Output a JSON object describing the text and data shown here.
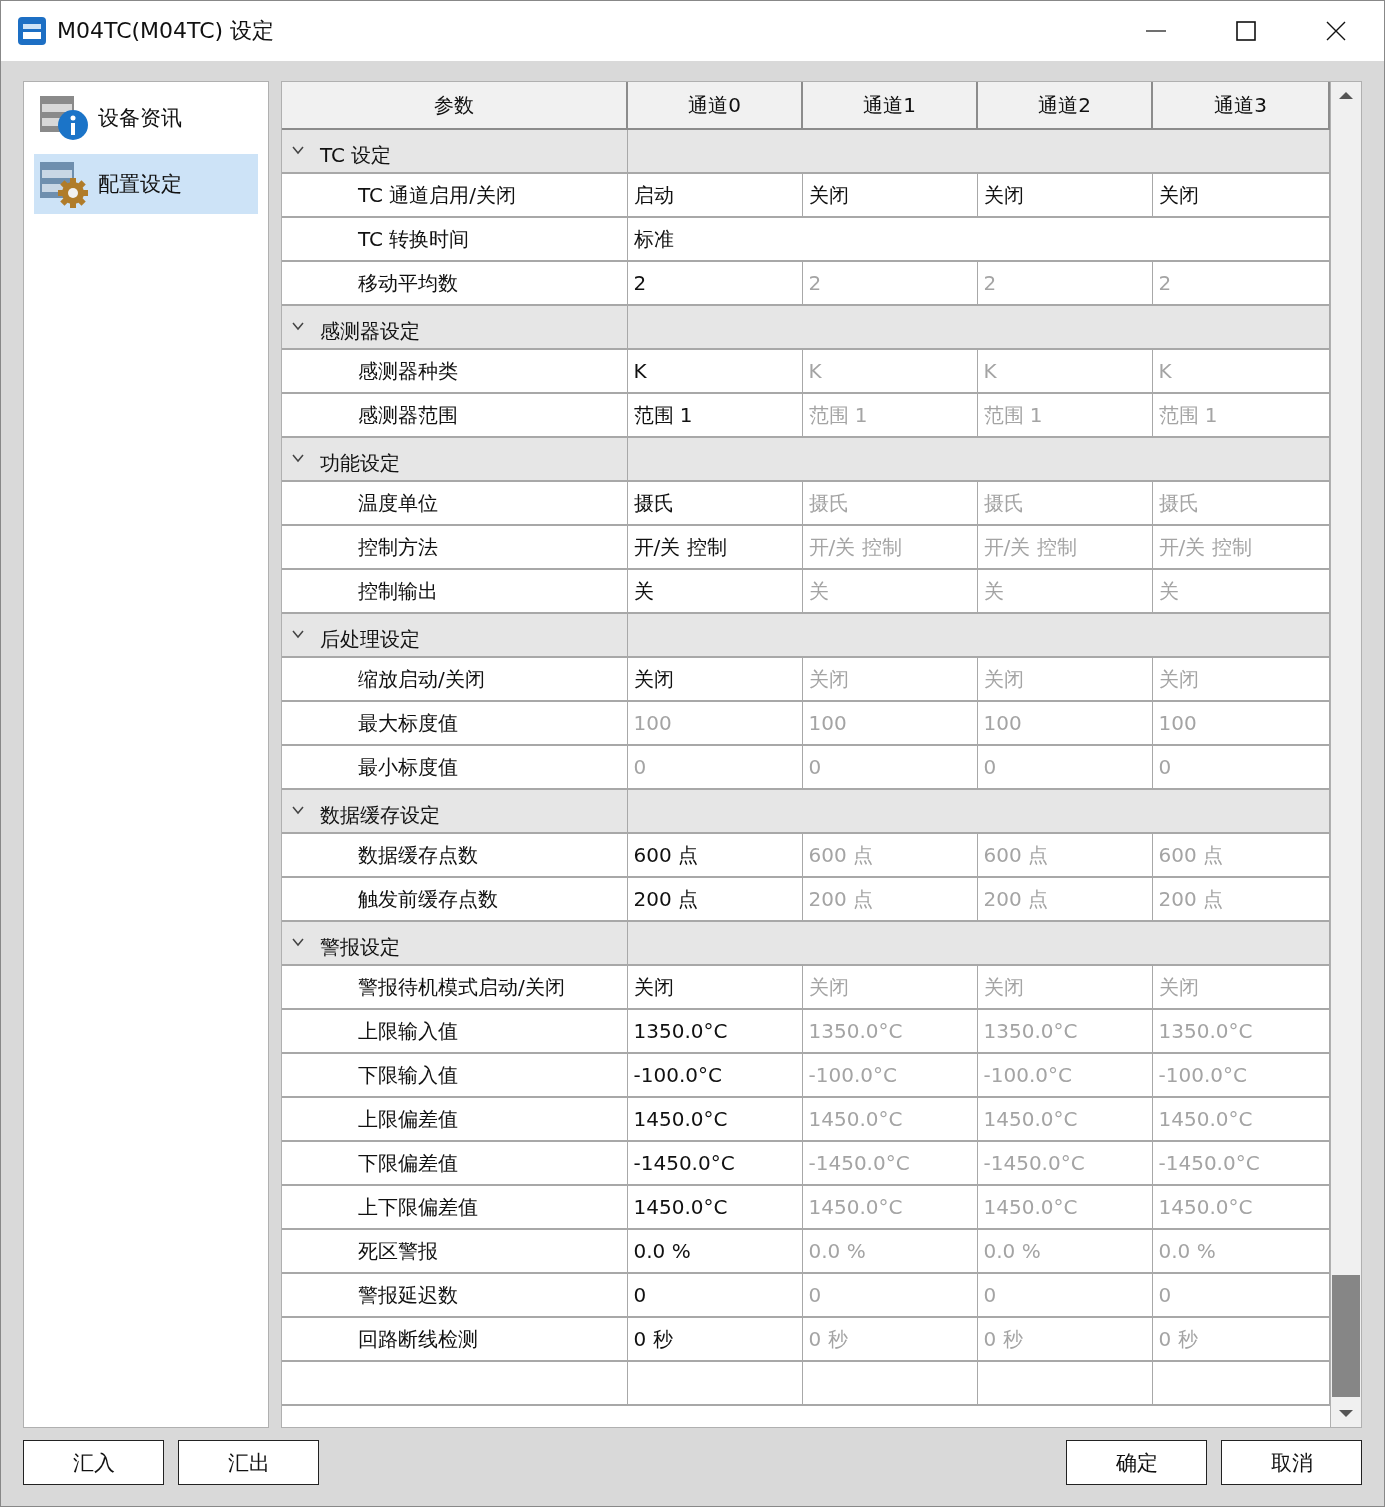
{
  "window": {
    "title": "M04TC(M04TC) 设定"
  },
  "sidebar": {
    "items": [
      {
        "label": "设备资讯",
        "kind": "info",
        "selected": false
      },
      {
        "label": "配置设定",
        "kind": "config",
        "selected": true
      }
    ]
  },
  "table": {
    "columns": [
      "参数",
      "通道0",
      "通道1",
      "通道2",
      "通道3"
    ],
    "groups": [
      {
        "label": "TC 设定",
        "expanded": true,
        "rows": [
          {
            "label": "TC 通道启用/关闭",
            "kind": "channels",
            "cells": [
              {
                "text": "启动",
                "disabled": false
              },
              {
                "text": "关闭",
                "disabled": false
              },
              {
                "text": "关闭",
                "disabled": false
              },
              {
                "text": "关闭",
                "disabled": false
              }
            ]
          },
          {
            "label": "TC 转换时间",
            "kind": "span",
            "cells": [
              {
                "text": "标准",
                "disabled": false,
                "colspan": 4
              }
            ]
          },
          {
            "label": "移动平均数",
            "kind": "channels",
            "cells": [
              {
                "text": "2",
                "disabled": false
              },
              {
                "text": "2",
                "disabled": true
              },
              {
                "text": "2",
                "disabled": true
              },
              {
                "text": "2",
                "disabled": true
              }
            ]
          }
        ]
      },
      {
        "label": "感测器设定",
        "expanded": true,
        "rows": [
          {
            "label": "感测器种类",
            "kind": "channels",
            "cells": [
              {
                "text": "K",
                "disabled": false
              },
              {
                "text": "K",
                "disabled": true
              },
              {
                "text": "K",
                "disabled": true
              },
              {
                "text": "K",
                "disabled": true
              }
            ]
          },
          {
            "label": "感测器范围",
            "kind": "channels",
            "cells": [
              {
                "text": "范围 1",
                "disabled": false
              },
              {
                "text": "范围 1",
                "disabled": true
              },
              {
                "text": "范围 1",
                "disabled": true
              },
              {
                "text": "范围 1",
                "disabled": true
              }
            ]
          }
        ]
      },
      {
        "label": "功能设定",
        "expanded": true,
        "rows": [
          {
            "label": "温度单位",
            "kind": "channels",
            "cells": [
              {
                "text": "摄氏",
                "disabled": false
              },
              {
                "text": "摄氏",
                "disabled": true
              },
              {
                "text": "摄氏",
                "disabled": true
              },
              {
                "text": "摄氏",
                "disabled": true
              }
            ]
          },
          {
            "label": "控制方法",
            "kind": "channels",
            "cells": [
              {
                "text": "开/关 控制",
                "disabled": false
              },
              {
                "text": "开/关 控制",
                "disabled": true
              },
              {
                "text": "开/关 控制",
                "disabled": true
              },
              {
                "text": "开/关 控制",
                "disabled": true
              }
            ]
          },
          {
            "label": "控制输出",
            "kind": "channels",
            "cells": [
              {
                "text": "关",
                "disabled": false
              },
              {
                "text": "关",
                "disabled": true
              },
              {
                "text": "关",
                "disabled": true
              },
              {
                "text": "关",
                "disabled": true
              }
            ]
          }
        ]
      },
      {
        "label": "后处理设定",
        "expanded": true,
        "rows": [
          {
            "label": "缩放启动/关闭",
            "kind": "channels",
            "cells": [
              {
                "text": "关闭",
                "disabled": false
              },
              {
                "text": "关闭",
                "disabled": true
              },
              {
                "text": "关闭",
                "disabled": true
              },
              {
                "text": "关闭",
                "disabled": true
              }
            ]
          },
          {
            "label": "最大标度值",
            "kind": "channels",
            "cells": [
              {
                "text": "100",
                "disabled": true
              },
              {
                "text": "100",
                "disabled": true
              },
              {
                "text": "100",
                "disabled": true
              },
              {
                "text": "100",
                "disabled": true
              }
            ]
          },
          {
            "label": "最小标度值",
            "kind": "channels",
            "cells": [
              {
                "text": "0",
                "disabled": true
              },
              {
                "text": "0",
                "disabled": true
              },
              {
                "text": "0",
                "disabled": true
              },
              {
                "text": "0",
                "disabled": true
              }
            ]
          }
        ]
      },
      {
        "label": "数据缓存设定",
        "expanded": true,
        "rows": [
          {
            "label": "数据缓存点数",
            "kind": "channels",
            "cells": [
              {
                "text": "600 点",
                "disabled": false
              },
              {
                "text": "600 点",
                "disabled": true
              },
              {
                "text": "600 点",
                "disabled": true
              },
              {
                "text": "600 点",
                "disabled": true
              }
            ]
          },
          {
            "label": "触发前缓存点数",
            "kind": "channels",
            "cells": [
              {
                "text": "200 点",
                "disabled": false
              },
              {
                "text": "200 点",
                "disabled": true
              },
              {
                "text": "200 点",
                "disabled": true
              },
              {
                "text": "200 点",
                "disabled": true
              }
            ]
          }
        ]
      },
      {
        "label": "警报设定",
        "expanded": true,
        "rows": [
          {
            "label": "警报待机模式启动/关闭",
            "kind": "channels",
            "cells": [
              {
                "text": "关闭",
                "disabled": false
              },
              {
                "text": "关闭",
                "disabled": true
              },
              {
                "text": "关闭",
                "disabled": true
              },
              {
                "text": "关闭",
                "disabled": true
              }
            ]
          },
          {
            "label": "上限输入值",
            "kind": "channels",
            "cells": [
              {
                "text": "1350.0°C",
                "disabled": false
              },
              {
                "text": "1350.0°C",
                "disabled": true
              },
              {
                "text": "1350.0°C",
                "disabled": true
              },
              {
                "text": "1350.0°C",
                "disabled": true
              }
            ]
          },
          {
            "label": "下限输入值",
            "kind": "channels",
            "cells": [
              {
                "text": "-100.0°C",
                "disabled": false
              },
              {
                "text": "-100.0°C",
                "disabled": true
              },
              {
                "text": "-100.0°C",
                "disabled": true
              },
              {
                "text": "-100.0°C",
                "disabled": true
              }
            ]
          },
          {
            "label": "上限偏差值",
            "kind": "channels",
            "cells": [
              {
                "text": "1450.0°C",
                "disabled": false
              },
              {
                "text": "1450.0°C",
                "disabled": true
              },
              {
                "text": "1450.0°C",
                "disabled": true
              },
              {
                "text": "1450.0°C",
                "disabled": true
              }
            ]
          },
          {
            "label": "下限偏差值",
            "kind": "channels",
            "cells": [
              {
                "text": "-1450.0°C",
                "disabled": false
              },
              {
                "text": "-1450.0°C",
                "disabled": true
              },
              {
                "text": "-1450.0°C",
                "disabled": true
              },
              {
                "text": "-1450.0°C",
                "disabled": true
              }
            ]
          },
          {
            "label": "上下限偏差值",
            "kind": "channels",
            "cells": [
              {
                "text": "1450.0°C",
                "disabled": false
              },
              {
                "text": "1450.0°C",
                "disabled": true
              },
              {
                "text": "1450.0°C",
                "disabled": true
              },
              {
                "text": "1450.0°C",
                "disabled": true
              }
            ]
          },
          {
            "label": "死区警报",
            "kind": "channels",
            "cells": [
              {
                "text": "0.0 %",
                "disabled": false
              },
              {
                "text": "0.0 %",
                "disabled": true
              },
              {
                "text": "0.0 %",
                "disabled": true
              },
              {
                "text": "0.0 %",
                "disabled": true
              }
            ]
          },
          {
            "label": "警报延迟数",
            "kind": "channels",
            "cells": [
              {
                "text": "0",
                "disabled": false
              },
              {
                "text": "0",
                "disabled": true
              },
              {
                "text": "0",
                "disabled": true
              },
              {
                "text": "0",
                "disabled": true
              }
            ]
          },
          {
            "label": "回路断线检测",
            "kind": "channels",
            "cells": [
              {
                "text": "0 秒",
                "disabled": false
              },
              {
                "text": "0 秒",
                "disabled": true
              },
              {
                "text": "0 秒",
                "disabled": true
              },
              {
                "text": "0 秒",
                "disabled": true
              }
            ]
          }
        ]
      }
    ]
  },
  "buttons_left": [
    "汇入",
    "汇出"
  ],
  "buttons_right": [
    "确定",
    "取消"
  ]
}
